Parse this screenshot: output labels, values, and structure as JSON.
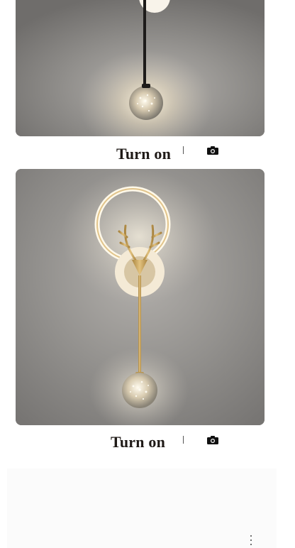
{
  "captions": [
    {
      "text": "Turn on",
      "camera_icon": "camera-icon"
    },
    {
      "text": "Turn on",
      "camera_icon": "camera-icon"
    }
  ],
  "photos": [
    {
      "subject": "wall-lamp-black-rod-glass-globe"
    },
    {
      "subject": "wall-lamp-gold-ring-antler-glass-globe"
    }
  ],
  "menu_icon": "more-vertical-icon",
  "colors": {
    "wall": "#8f8d8b",
    "gold": "#c9a35a",
    "caption_text": "#1f1a17"
  }
}
